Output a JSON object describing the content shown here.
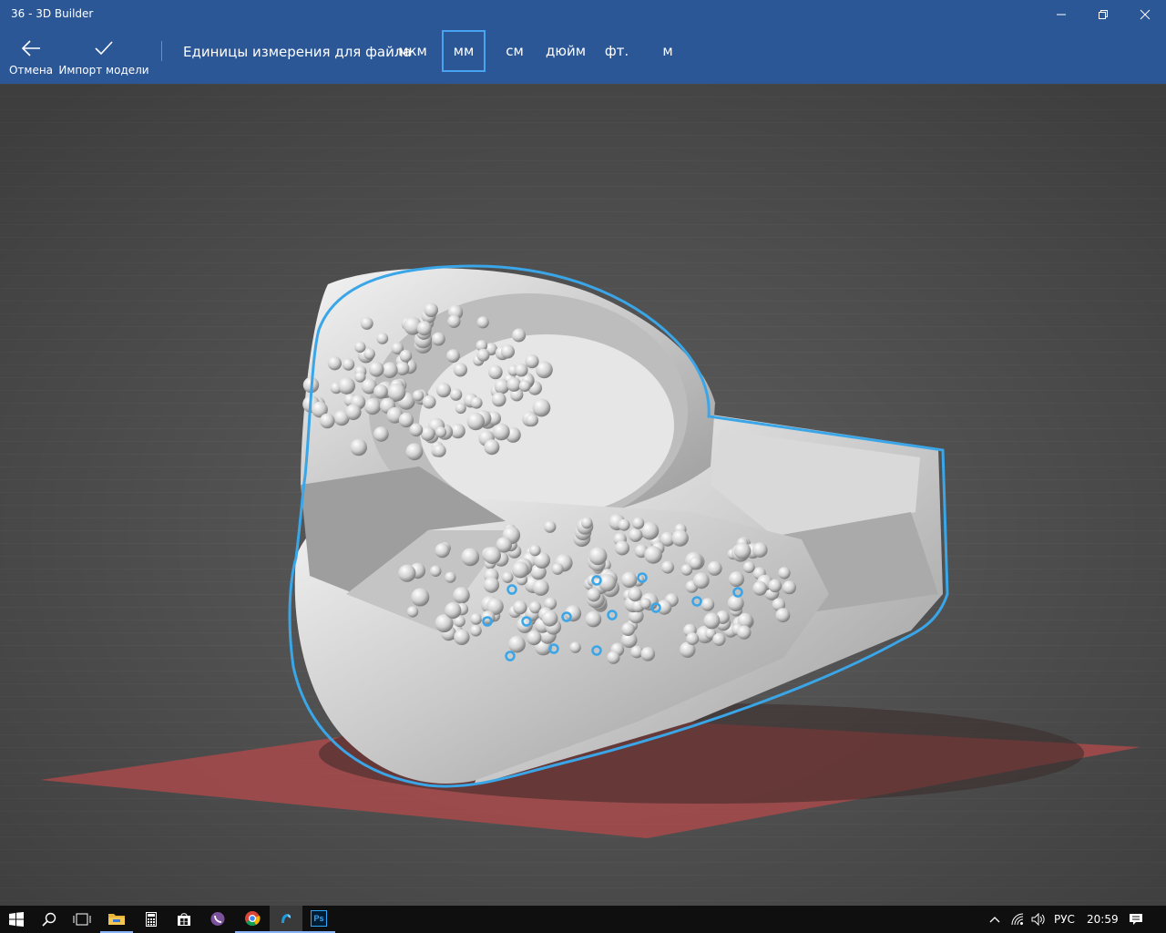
{
  "window": {
    "title": "36 - 3D Builder",
    "minimize_icon": "minimize-icon",
    "maximize_icon": "restore-icon",
    "close_icon": "close-icon"
  },
  "command_bar": {
    "cancel": {
      "label": "Отмена",
      "icon": "back-arrow-icon"
    },
    "import": {
      "label": "Импорт модели",
      "icon": "checkmark-icon"
    },
    "units_label": "Единицы измерения для файла",
    "units": [
      {
        "label": "мкм",
        "selected": false
      },
      {
        "label": "мм",
        "selected": true
      },
      {
        "label": "см",
        "selected": false
      },
      {
        "label": "дюйм",
        "selected": false
      },
      {
        "label": "фт.",
        "selected": false
      },
      {
        "label": "м",
        "selected": false
      }
    ],
    "accent_color": "#2b5797",
    "selection_color": "#4aa3f0"
  },
  "viewport": {
    "model": "ring-model",
    "outline_color": "#3aa6e8",
    "plate_color": "#b44a4a",
    "background_color": "#5f5f5f"
  },
  "taskbar": {
    "apps": [
      {
        "name": "start-button",
        "icon": "windows-logo-icon"
      },
      {
        "name": "search-button",
        "icon": "search-icon"
      },
      {
        "name": "task-view-button",
        "icon": "task-view-icon"
      },
      {
        "name": "file-explorer",
        "icon": "folder-icon"
      },
      {
        "name": "calculator",
        "icon": "calculator-icon"
      },
      {
        "name": "store",
        "icon": "store-bag-icon"
      },
      {
        "name": "viber",
        "icon": "viber-icon"
      },
      {
        "name": "chrome",
        "icon": "chrome-icon"
      },
      {
        "name": "3d-builder",
        "icon": "3d-builder-icon"
      },
      {
        "name": "photoshop",
        "icon": "photoshop-icon",
        "text": "Ps"
      }
    ],
    "tray": {
      "language": "РУС",
      "time": "20:59",
      "icons": [
        "chevron-up-icon",
        "network-icon",
        "volume-icon",
        "notification-icon"
      ]
    }
  }
}
